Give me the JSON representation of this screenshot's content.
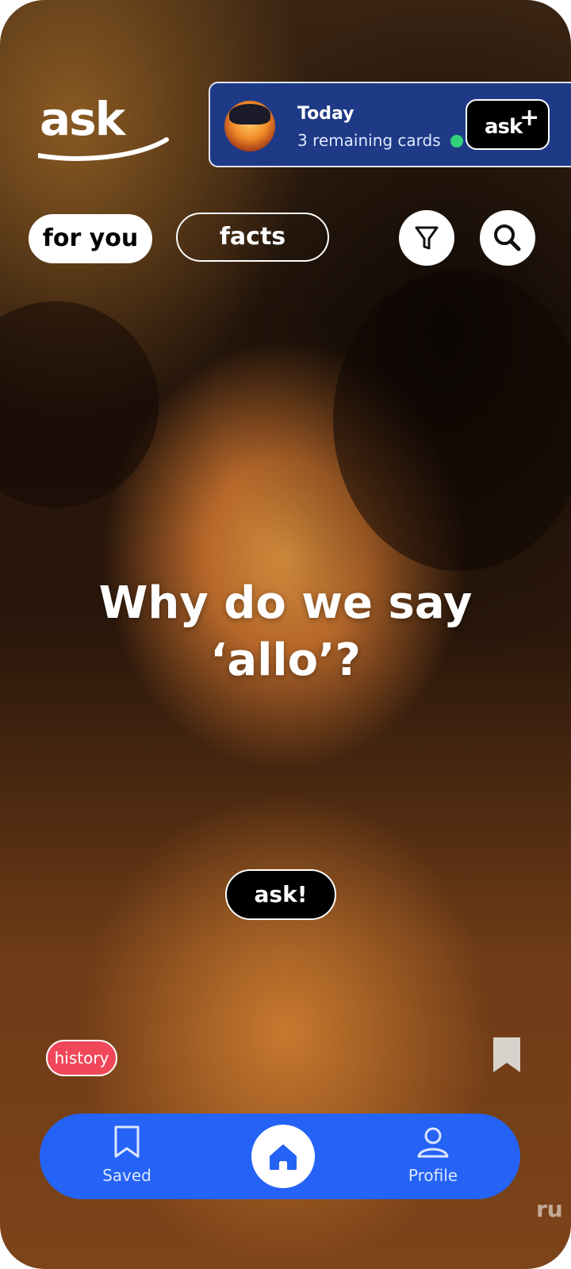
{
  "app": {
    "logo_text": "ask"
  },
  "today_card": {
    "title": "Today",
    "subtitle": "3 remaining cards",
    "status_color": "#33d17a",
    "action_label": "ask",
    "action_suffix": "+"
  },
  "filters": {
    "tabs": [
      {
        "label": "for you",
        "selected": true
      },
      {
        "label": "facts",
        "selected": false
      }
    ],
    "filter_icon": "filter-icon",
    "search_icon": "search-icon"
  },
  "card": {
    "question": "Why do we say ‘allo’?",
    "ask_label": "ask!",
    "category_tag": "history",
    "category_color": "#f0475a",
    "bookmark_icon": "bookmark-icon",
    "watermark": "ru"
  },
  "bottom_nav": {
    "items": [
      {
        "label": "Saved",
        "icon": "bookmark-icon"
      },
      {
        "label": "",
        "icon": "home-icon",
        "active": true
      },
      {
        "label": "Profile",
        "icon": "user-icon"
      }
    ],
    "color": "#2463f5"
  }
}
